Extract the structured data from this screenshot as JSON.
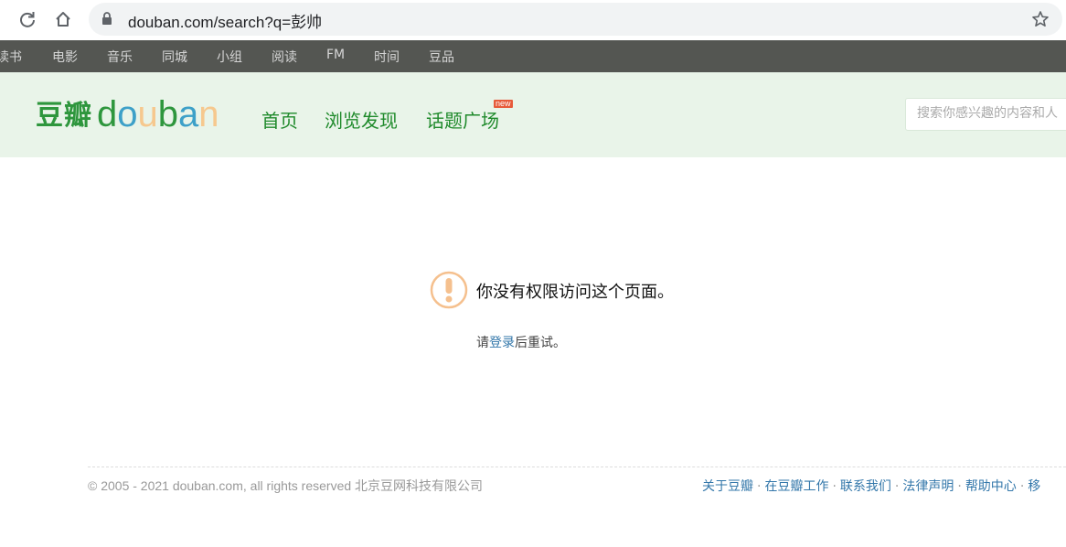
{
  "browser": {
    "url": "douban.com/search?q=彭帅"
  },
  "global_nav": {
    "items": [
      "读书",
      "电影",
      "音乐",
      "同城",
      "小组",
      "阅读",
      "FM",
      "时间",
      "豆品"
    ]
  },
  "header": {
    "logo_cn": "豆瓣",
    "logo_en_letters": [
      "d",
      "o",
      "u",
      "b",
      "a",
      "n"
    ],
    "logo_en_colors": [
      "#2e963d",
      "#3da0c8",
      "#f6c88e",
      "#2e963d",
      "#3da0c8",
      "#f6c88e"
    ],
    "nav": [
      "首页",
      "浏览发现",
      "话题广场"
    ],
    "new_badge": "new",
    "search_placeholder": "搜索你感兴趣的内容和人"
  },
  "message": {
    "title": "你没有权限访问这个页面。",
    "retry_prefix": "请",
    "login_link": "登录",
    "retry_suffix": "后重试。"
  },
  "footer": {
    "copyright": "© 2005 - 2021 douban.com, all rights reserved 北京豆网科技有限公司",
    "links": [
      "关于豆瓣",
      "在豆瓣工作",
      "联系我们",
      "法律声明",
      "帮助中心",
      "移"
    ]
  },
  "colors": {
    "brand_green": "#2e963d",
    "nav_dark": "#545652",
    "header_bg": "#e9f4e9",
    "link_blue": "#3377aa",
    "warning_orange": "#f5c08e"
  }
}
